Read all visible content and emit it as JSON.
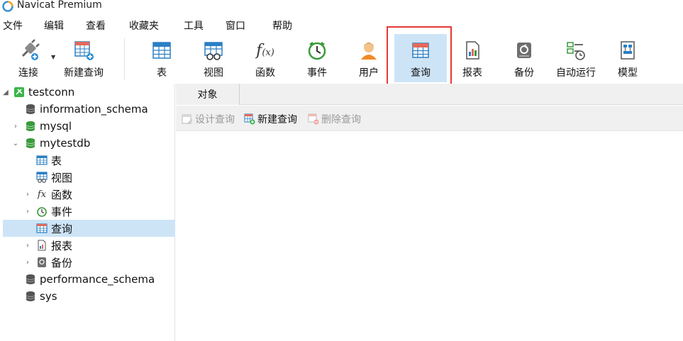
{
  "window": {
    "title": "Navicat Premium",
    "logo_icon": "navicat-logo-icon"
  },
  "menu": [
    "文件",
    "编辑",
    "查看",
    "收藏夹",
    "工具",
    "窗口",
    "帮助"
  ],
  "toolbar": {
    "connect_label": "连接",
    "new_query_label": "新建查询",
    "items": [
      {
        "label": "表",
        "icon": "table-icon"
      },
      {
        "label": "视图",
        "icon": "view-icon"
      },
      {
        "label": "函数",
        "icon": "function-icon"
      },
      {
        "label": "事件",
        "icon": "event-clock-icon"
      },
      {
        "label": "用户",
        "icon": "user-icon"
      },
      {
        "label": "查询",
        "icon": "query-icon"
      },
      {
        "label": "报表",
        "icon": "report-icon"
      },
      {
        "label": "备份",
        "icon": "backup-icon"
      },
      {
        "label": "自动运行",
        "icon": "automation-icon"
      },
      {
        "label": "模型",
        "icon": "model-icon"
      }
    ],
    "active_item": "查询",
    "highlight_color": "#cde4f7",
    "annotation_color": "#e53935"
  },
  "tree": {
    "connection": "testconn",
    "nodes": [
      {
        "label": "information_schema",
        "icon": "database-icon"
      },
      {
        "label": "mysql",
        "icon": "database-icon"
      },
      {
        "label": "mytestdb",
        "icon": "database-icon"
      },
      {
        "label": "表",
        "icon": "table-icon"
      },
      {
        "label": "视图",
        "icon": "view-icon"
      },
      {
        "label": "函数",
        "icon": "function-icon"
      },
      {
        "label": "事件",
        "icon": "event-clock-icon"
      },
      {
        "label": "查询",
        "icon": "query-icon"
      },
      {
        "label": "报表",
        "icon": "report-icon"
      },
      {
        "label": "备份",
        "icon": "backup-icon"
      },
      {
        "label": "performance_schema",
        "icon": "database-icon"
      },
      {
        "label": "sys",
        "icon": "database-icon"
      }
    ],
    "selected": "查询"
  },
  "main": {
    "tab_label": "对象",
    "object_toolbar": {
      "design_query": "设计查询",
      "new_query": "新建查询",
      "delete_query": "删除查询"
    }
  }
}
